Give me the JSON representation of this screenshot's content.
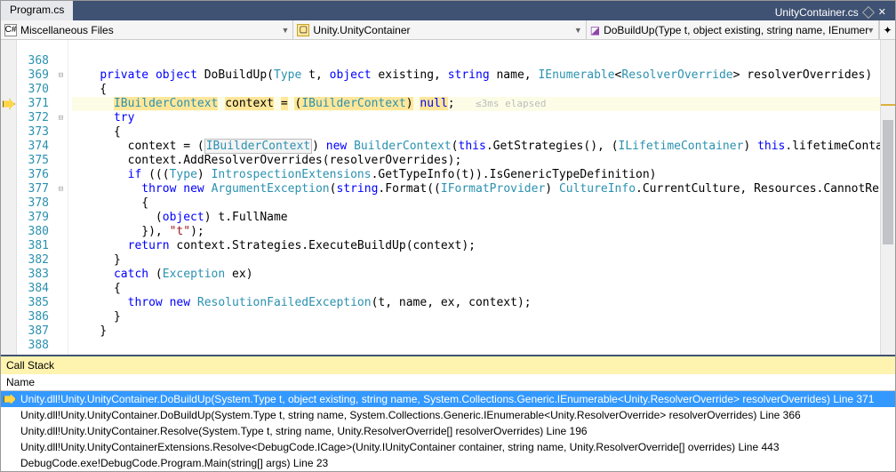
{
  "tabs": {
    "left": "Program.cs",
    "right": "UnityContainer.cs"
  },
  "navbar": {
    "files": "Miscellaneous Files",
    "class": "Unity.UnityContainer",
    "member": "DoBuildUp(Type t, object existing, string name, IEnumer"
  },
  "code": {
    "lines": [
      {
        "n": "",
        "t": ""
      },
      {
        "n": "368",
        "t": ""
      },
      {
        "n": "369",
        "t": "    private object DoBuildUp(Type t, object existing, string name, IEnumerable<ResolverOverride> resolverOverrides)",
        "fold": "-"
      },
      {
        "n": "370",
        "t": "    {"
      },
      {
        "n": "371",
        "t": "      IBuilderContext context = (IBuilderContext) null;   ≤3ms elapsed",
        "hl": true,
        "arrow": true
      },
      {
        "n": "372",
        "t": "      try",
        "fold": "-"
      },
      {
        "n": "373",
        "t": "      {"
      },
      {
        "n": "374",
        "t": "        context = (IBuilderContext) new BuilderContext(this.GetStrategies(), (ILifetimeContainer) this.lifetimeContainer, (IPol"
      },
      {
        "n": "375",
        "t": "        context.AddResolverOverrides(resolverOverrides);"
      },
      {
        "n": "376",
        "t": "        if (((Type) IntrospectionExtensions.GetTypeInfo(t)).IsGenericTypeDefinition)"
      },
      {
        "n": "377",
        "t": "          throw new ArgumentException(string.Format((IFormatProvider) CultureInfo.CurrentCulture, Resources.CannotResolveOpenGe",
        "fold": "-"
      },
      {
        "n": "378",
        "t": "          {"
      },
      {
        "n": "379",
        "t": "            (object) t.FullName"
      },
      {
        "n": "380",
        "t": "          }), \"t\");"
      },
      {
        "n": "381",
        "t": "        return context.Strategies.ExecuteBuildUp(context);"
      },
      {
        "n": "382",
        "t": "      }"
      },
      {
        "n": "383",
        "t": "      catch (Exception ex)"
      },
      {
        "n": "384",
        "t": "      {"
      },
      {
        "n": "385",
        "t": "        throw new ResolutionFailedException(t, name, ex, context);"
      },
      {
        "n": "386",
        "t": "      }"
      },
      {
        "n": "387",
        "t": "    }"
      },
      {
        "n": "388",
        "t": ""
      }
    ]
  },
  "callstack": {
    "title": "Call Stack",
    "header": "Name",
    "rows": [
      {
        "arrow": true,
        "sel": true,
        "text": "Unity.dll!Unity.UnityContainer.DoBuildUp(System.Type t, object existing, string name, System.Collections.Generic.IEnumerable<Unity.ResolverOverride> resolverOverrides) Line 371"
      },
      {
        "text": "Unity.dll!Unity.UnityContainer.DoBuildUp(System.Type t, string name, System.Collections.Generic.IEnumerable<Unity.ResolverOverride> resolverOverrides) Line 366"
      },
      {
        "text": "Unity.dll!Unity.UnityContainer.Resolve(System.Type t, string name, Unity.ResolverOverride[] resolverOverrides) Line 196"
      },
      {
        "text": "Unity.dll!Unity.UnityContainerExtensions.Resolve<DebugCode.ICage>(Unity.IUnityContainer container, string name, Unity.ResolverOverride[] overrides) Line 443"
      },
      {
        "text": "DebugCode.exe!DebugCode.Program.Main(string[] args) Line 23"
      }
    ]
  }
}
